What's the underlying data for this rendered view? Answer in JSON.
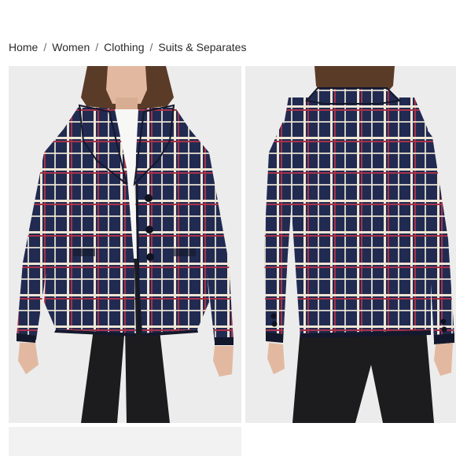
{
  "breadcrumb": {
    "items": [
      {
        "label": "Home"
      },
      {
        "label": "Women"
      },
      {
        "label": "Clothing"
      },
      {
        "label": "Suits & Separates"
      }
    ],
    "separator": "/"
  },
  "gallery": {
    "images": [
      {
        "name": "product-image-front",
        "subject": "model wearing navy plaid tweed jacket, front view"
      },
      {
        "name": "product-image-back",
        "subject": "model wearing navy plaid tweed jacket, back view"
      }
    ]
  },
  "colors": {
    "background": "#ffffff",
    "photo_bg": "#ececec",
    "jacket_navy": "#1f2748",
    "plaid_cream": "#efe6d6",
    "plaid_red": "#a8324a",
    "pants": "#1c1c1e",
    "skin": "#e2b9a0",
    "hair": "#5a3b28"
  }
}
